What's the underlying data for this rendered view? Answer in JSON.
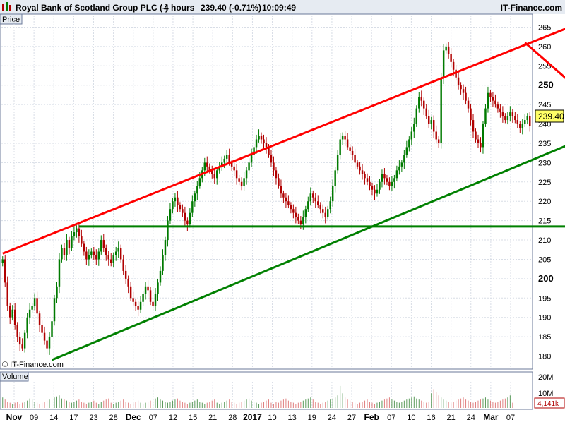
{
  "header": {
    "title": "Royal Bank of Scotland Group PLC (-)",
    "interval": "4 hours",
    "quote": "239.40 (-0.71%)",
    "time": "10:09:49",
    "brand": "IT-Finance.com"
  },
  "price_panel": {
    "label": "Price",
    "watermark": "© IT-Finance.com"
  },
  "volume_panel": {
    "label": "Volume",
    "tick_labels": [
      "20M",
      "10M"
    ],
    "last_volume": "4,141k"
  },
  "last_price_label": "239.40",
  "colors": {
    "up": "#007a00",
    "down": "#b00000",
    "channel_upper": "#ff0000",
    "channel_lower": "#008000",
    "support": "#008000",
    "resistance": "#ff0000",
    "grid": "#d8dde6",
    "frame": "#6b7a99",
    "header_bg": "#e6ebf2",
    "last_price_bg": "#ffff66"
  },
  "chart_data": {
    "type": "candlestick",
    "title": "Royal Bank of Scotland Group PLC (-)",
    "interval": "4 hours",
    "ylim": [
      177,
      268
    ],
    "yticks": [
      180,
      185,
      190,
      195,
      200,
      205,
      210,
      215,
      220,
      225,
      230,
      235,
      240,
      245,
      250,
      255,
      260,
      265
    ],
    "ytick_major": [
      200,
      250
    ],
    "xticks": [
      {
        "label": "Nov",
        "bold": true
      },
      {
        "label": "09"
      },
      {
        "label": "14"
      },
      {
        "label": "17"
      },
      {
        "label": "23"
      },
      {
        "label": "28"
      },
      {
        "label": "Dec",
        "bold": true
      },
      {
        "label": "07"
      },
      {
        "label": "12"
      },
      {
        "label": "15"
      },
      {
        "label": "21"
      },
      {
        "label": "28"
      },
      {
        "label": "2017",
        "bold": true
      },
      {
        "label": "10"
      },
      {
        "label": "13"
      },
      {
        "label": "19"
      },
      {
        "label": "24"
      },
      {
        "label": "27"
      },
      {
        "label": "Feb",
        "bold": true
      },
      {
        "label": "07"
      },
      {
        "label": "10"
      },
      {
        "label": "16"
      },
      {
        "label": "21"
      },
      {
        "label": "24"
      },
      {
        "label": "Mar",
        "bold": true
      },
      {
        "label": "07"
      }
    ],
    "last_price": 239.4,
    "change_pct": -0.71,
    "trendlines": [
      {
        "name": "upper-channel",
        "from": [
          0,
          206.5
        ],
        "to": [
          234,
          266
        ]
      },
      {
        "name": "lower-channel",
        "from": [
          20,
          179
        ],
        "to": [
          250,
          240
        ]
      },
      {
        "name": "horizontal-support",
        "from": [
          31,
          213.5
        ],
        "to": [
          248,
          213.5
        ]
      },
      {
        "name": "short-term-resistance",
        "from": [
          212,
          261
        ],
        "to": [
          248,
          241
        ]
      }
    ],
    "closes": [
      205,
      199,
      193,
      190,
      192,
      188,
      185,
      183,
      182,
      186,
      190,
      192,
      193,
      195,
      191,
      188,
      186,
      184,
      182,
      185,
      189,
      195,
      198,
      205,
      208,
      206,
      210,
      208,
      211,
      212,
      213,
      211,
      209,
      207,
      205,
      206,
      207,
      206,
      205,
      207,
      210,
      208,
      206,
      205,
      204,
      206,
      207,
      208,
      205,
      202,
      200,
      198,
      195,
      194,
      193,
      192,
      194,
      196,
      198,
      197,
      194,
      193,
      196,
      199,
      202,
      206,
      210,
      215,
      218,
      220,
      221,
      219,
      218,
      217,
      215,
      214,
      217,
      220,
      222,
      224,
      226,
      228,
      230,
      229,
      228,
      227,
      226,
      228,
      229,
      230,
      231,
      232,
      230,
      229,
      228,
      226,
      225,
      224,
      226,
      228,
      230,
      232,
      234,
      236,
      237,
      236,
      235,
      234,
      232,
      230,
      228,
      226,
      224,
      222,
      221,
      220,
      219,
      218,
      217,
      216,
      215,
      214,
      216,
      218,
      220,
      222,
      221,
      220,
      219,
      218,
      217,
      216,
      218,
      220,
      224,
      228,
      232,
      236,
      237,
      236,
      234,
      233,
      232,
      230,
      229,
      228,
      227,
      226,
      225,
      224,
      223,
      222,
      223,
      225,
      227,
      226,
      225,
      224,
      225,
      226,
      228,
      229,
      230,
      232,
      234,
      236,
      238,
      240,
      244,
      247,
      246,
      244,
      242,
      240,
      241,
      238,
      236,
      235,
      252,
      259,
      260,
      258,
      256,
      254,
      252,
      250,
      249,
      248,
      246,
      244,
      241,
      238,
      236,
      235,
      234,
      240,
      244,
      248,
      247,
      246,
      245,
      244,
      243,
      242,
      241,
      242,
      243,
      242,
      241,
      240,
      239,
      240,
      241,
      242,
      239.4
    ],
    "volumes": [
      10,
      8,
      6,
      5,
      4,
      5,
      6,
      4,
      5,
      6,
      7,
      9,
      8,
      6,
      5,
      4,
      5,
      6,
      7,
      8,
      9,
      10,
      11,
      12,
      9,
      8,
      7,
      6,
      5,
      6,
      7,
      8,
      6,
      5,
      4,
      5,
      6,
      7,
      5,
      4,
      6,
      7,
      8,
      9,
      5,
      4,
      5,
      6,
      7,
      8,
      6,
      5,
      4,
      5,
      6,
      7,
      5,
      4,
      5,
      6,
      7,
      8,
      9,
      10,
      8,
      7,
      6,
      5,
      6,
      7,
      8,
      9,
      7,
      6,
      5,
      4,
      5,
      6,
      7,
      8,
      6,
      5,
      4,
      5,
      6,
      7,
      8,
      5,
      4,
      5,
      6,
      7,
      8,
      6,
      5,
      4,
      5,
      6,
      7,
      8,
      9,
      7,
      6,
      5,
      4,
      5,
      6,
      7,
      8,
      5,
      4,
      6,
      5,
      7,
      8,
      9,
      7,
      6,
      5,
      4,
      5,
      6,
      7,
      8,
      9,
      10,
      8,
      6,
      5,
      4,
      5,
      6,
      7,
      8,
      9,
      10,
      12,
      21,
      14,
      10,
      8,
      7,
      6,
      5,
      4,
      5,
      6,
      7,
      8,
      6,
      5,
      4,
      5,
      6,
      7,
      8,
      9,
      10,
      8,
      7,
      6,
      5,
      6,
      7,
      8,
      9,
      10,
      11,
      9,
      8,
      7,
      6,
      5,
      6,
      14,
      18,
      15,
      12,
      10,
      8,
      7,
      6,
      5,
      6,
      7,
      8,
      9,
      10,
      8,
      7,
      6,
      5,
      6,
      7,
      8,
      9,
      10,
      8,
      7,
      6,
      5,
      6,
      7,
      8,
      9,
      10,
      12,
      5
    ]
  }
}
